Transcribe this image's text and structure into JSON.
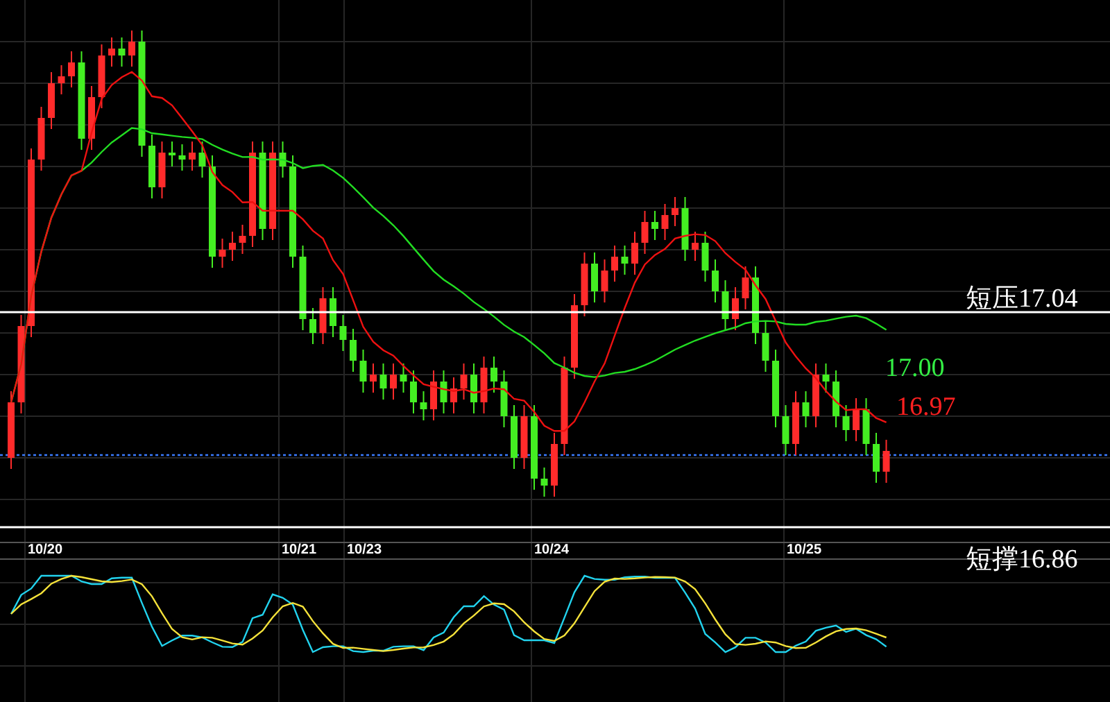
{
  "chart": {
    "x_labels": [
      "10/20",
      "10/21",
      "10/23",
      "10/24",
      "10/25"
    ],
    "levels": [
      {
        "kind": "resistance",
        "label": "短压17.04"
      },
      {
        "kind": "support",
        "label": "短撑16.86"
      }
    ],
    "ma_labels": [
      {
        "label": "17.00",
        "color": "#33ee44"
      },
      {
        "label": "16.97",
        "color": "#ff2020"
      }
    ]
  }
}
